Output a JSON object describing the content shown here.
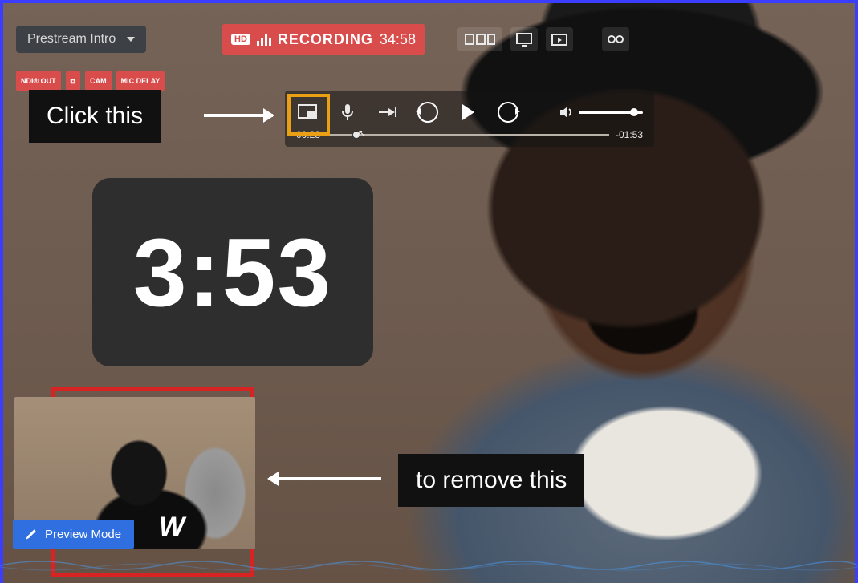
{
  "scene_selector": {
    "label": "Prestream Intro"
  },
  "status_chips": {
    "ndi": "NDI® OUT",
    "share": "⧉",
    "cam": "CAM",
    "mic": "MIC DELAY"
  },
  "recording": {
    "hd": "HD",
    "label": "RECORDING",
    "time": "34:58"
  },
  "header_icons": {
    "multiview": "multiview",
    "display": "display",
    "media": "media",
    "audio": "audio-vu"
  },
  "player": {
    "current": "00:28",
    "remaining": "-01:53",
    "volume_pct": 90,
    "seek_pct": 9
  },
  "timer": {
    "value": "3:53"
  },
  "thumbnail": {
    "overlay_letter": "W"
  },
  "preview_button": {
    "label": "Preview Mode"
  },
  "annotations": {
    "click": "Click this",
    "remove": "to remove this"
  }
}
